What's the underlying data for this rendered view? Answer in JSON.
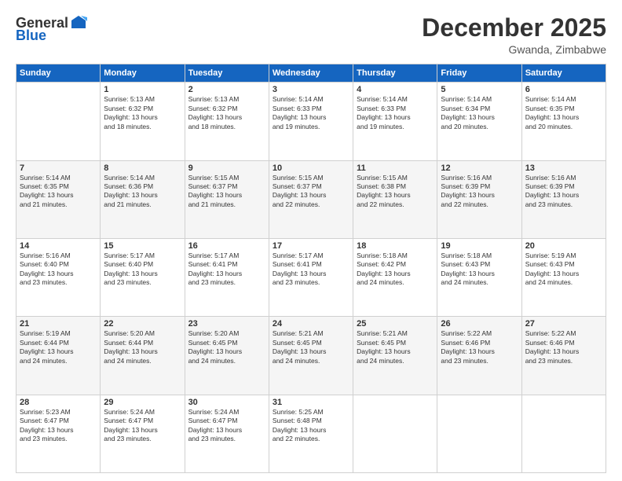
{
  "logo": {
    "general": "General",
    "blue": "Blue"
  },
  "title": "December 2025",
  "location": "Gwanda, Zimbabwe",
  "days_header": [
    "Sunday",
    "Monday",
    "Tuesday",
    "Wednesday",
    "Thursday",
    "Friday",
    "Saturday"
  ],
  "weeks": [
    [
      {
        "num": "",
        "text": ""
      },
      {
        "num": "1",
        "text": "Sunrise: 5:13 AM\nSunset: 6:32 PM\nDaylight: 13 hours\nand 18 minutes."
      },
      {
        "num": "2",
        "text": "Sunrise: 5:13 AM\nSunset: 6:32 PM\nDaylight: 13 hours\nand 18 minutes."
      },
      {
        "num": "3",
        "text": "Sunrise: 5:14 AM\nSunset: 6:33 PM\nDaylight: 13 hours\nand 19 minutes."
      },
      {
        "num": "4",
        "text": "Sunrise: 5:14 AM\nSunset: 6:33 PM\nDaylight: 13 hours\nand 19 minutes."
      },
      {
        "num": "5",
        "text": "Sunrise: 5:14 AM\nSunset: 6:34 PM\nDaylight: 13 hours\nand 20 minutes."
      },
      {
        "num": "6",
        "text": "Sunrise: 5:14 AM\nSunset: 6:35 PM\nDaylight: 13 hours\nand 20 minutes."
      }
    ],
    [
      {
        "num": "7",
        "text": "Sunrise: 5:14 AM\nSunset: 6:35 PM\nDaylight: 13 hours\nand 21 minutes."
      },
      {
        "num": "8",
        "text": "Sunrise: 5:14 AM\nSunset: 6:36 PM\nDaylight: 13 hours\nand 21 minutes."
      },
      {
        "num": "9",
        "text": "Sunrise: 5:15 AM\nSunset: 6:37 PM\nDaylight: 13 hours\nand 21 minutes."
      },
      {
        "num": "10",
        "text": "Sunrise: 5:15 AM\nSunset: 6:37 PM\nDaylight: 13 hours\nand 22 minutes."
      },
      {
        "num": "11",
        "text": "Sunrise: 5:15 AM\nSunset: 6:38 PM\nDaylight: 13 hours\nand 22 minutes."
      },
      {
        "num": "12",
        "text": "Sunrise: 5:16 AM\nSunset: 6:39 PM\nDaylight: 13 hours\nand 22 minutes."
      },
      {
        "num": "13",
        "text": "Sunrise: 5:16 AM\nSunset: 6:39 PM\nDaylight: 13 hours\nand 23 minutes."
      }
    ],
    [
      {
        "num": "14",
        "text": "Sunrise: 5:16 AM\nSunset: 6:40 PM\nDaylight: 13 hours\nand 23 minutes."
      },
      {
        "num": "15",
        "text": "Sunrise: 5:17 AM\nSunset: 6:40 PM\nDaylight: 13 hours\nand 23 minutes."
      },
      {
        "num": "16",
        "text": "Sunrise: 5:17 AM\nSunset: 6:41 PM\nDaylight: 13 hours\nand 23 minutes."
      },
      {
        "num": "17",
        "text": "Sunrise: 5:17 AM\nSunset: 6:41 PM\nDaylight: 13 hours\nand 23 minutes."
      },
      {
        "num": "18",
        "text": "Sunrise: 5:18 AM\nSunset: 6:42 PM\nDaylight: 13 hours\nand 24 minutes."
      },
      {
        "num": "19",
        "text": "Sunrise: 5:18 AM\nSunset: 6:43 PM\nDaylight: 13 hours\nand 24 minutes."
      },
      {
        "num": "20",
        "text": "Sunrise: 5:19 AM\nSunset: 6:43 PM\nDaylight: 13 hours\nand 24 minutes."
      }
    ],
    [
      {
        "num": "21",
        "text": "Sunrise: 5:19 AM\nSunset: 6:44 PM\nDaylight: 13 hours\nand 24 minutes."
      },
      {
        "num": "22",
        "text": "Sunrise: 5:20 AM\nSunset: 6:44 PM\nDaylight: 13 hours\nand 24 minutes."
      },
      {
        "num": "23",
        "text": "Sunrise: 5:20 AM\nSunset: 6:45 PM\nDaylight: 13 hours\nand 24 minutes."
      },
      {
        "num": "24",
        "text": "Sunrise: 5:21 AM\nSunset: 6:45 PM\nDaylight: 13 hours\nand 24 minutes."
      },
      {
        "num": "25",
        "text": "Sunrise: 5:21 AM\nSunset: 6:45 PM\nDaylight: 13 hours\nand 24 minutes."
      },
      {
        "num": "26",
        "text": "Sunrise: 5:22 AM\nSunset: 6:46 PM\nDaylight: 13 hours\nand 23 minutes."
      },
      {
        "num": "27",
        "text": "Sunrise: 5:22 AM\nSunset: 6:46 PM\nDaylight: 13 hours\nand 23 minutes."
      }
    ],
    [
      {
        "num": "28",
        "text": "Sunrise: 5:23 AM\nSunset: 6:47 PM\nDaylight: 13 hours\nand 23 minutes."
      },
      {
        "num": "29",
        "text": "Sunrise: 5:24 AM\nSunset: 6:47 PM\nDaylight: 13 hours\nand 23 minutes."
      },
      {
        "num": "30",
        "text": "Sunrise: 5:24 AM\nSunset: 6:47 PM\nDaylight: 13 hours\nand 23 minutes."
      },
      {
        "num": "31",
        "text": "Sunrise: 5:25 AM\nSunset: 6:48 PM\nDaylight: 13 hours\nand 22 minutes."
      },
      {
        "num": "",
        "text": ""
      },
      {
        "num": "",
        "text": ""
      },
      {
        "num": "",
        "text": ""
      }
    ]
  ]
}
